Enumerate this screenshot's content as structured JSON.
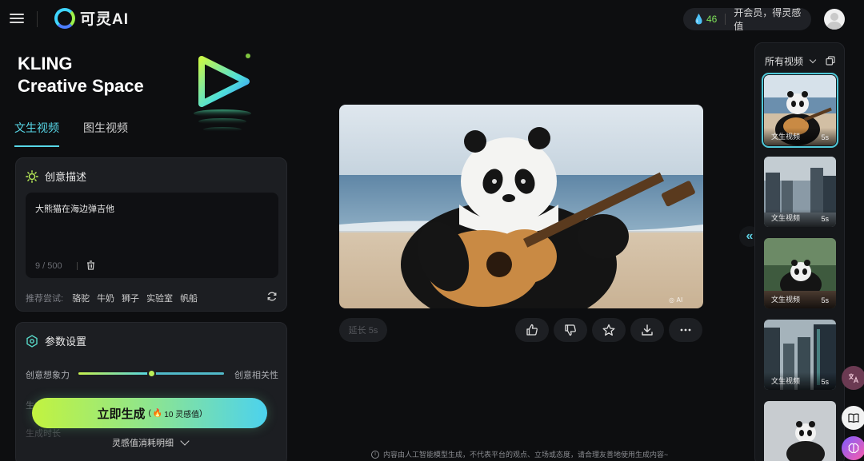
{
  "topbar": {
    "brand": "可灵AI",
    "credits": "46",
    "vip_text": "开会员，得灵感值"
  },
  "hero": {
    "line1": "KLING",
    "line2": "Creative Space"
  },
  "tabs": [
    {
      "label": "文生视频",
      "active": true
    },
    {
      "label": "图生视频",
      "active": false
    }
  ],
  "creative": {
    "title": "创意描述",
    "prompt": "大熊猫在海边弹吉他",
    "char_count": "9 / 500",
    "suggest_label": "推荐尝试:",
    "suggestions": [
      "骆驼",
      "牛奶",
      "狮子",
      "实验室",
      "帆船"
    ]
  },
  "params": {
    "title": "参数设置",
    "slider_left": "创意想象力",
    "slider_right": "创意相关性",
    "slider_value": 0.5,
    "row2_faded": "生成模式",
    "row3_faded": "生成时长"
  },
  "generate": {
    "label": "立即生成",
    "cost": "10 灵感值"
  },
  "cost_detail": "灵感值消耗明细",
  "video": {
    "extend_label": "延长 5s",
    "actions": [
      "thumbs-up-icon",
      "thumbs-down-icon",
      "star-icon",
      "download-icon",
      "more-icon"
    ]
  },
  "disclaimer": "内容由人工智能模型生成，不代表平台的观点、立场或态度，请合理友善地使用生成内容~",
  "rail": {
    "title": "所有视频",
    "items": [
      {
        "type": "文生视频",
        "duration": "5s",
        "active": true,
        "scene": "panda-guitar"
      },
      {
        "type": "文生视频",
        "duration": "5s",
        "active": false,
        "scene": "city-street"
      },
      {
        "type": "文生视频",
        "duration": "5s",
        "active": false,
        "scene": "panda-forest"
      },
      {
        "type": "文生视频",
        "duration": "5s",
        "active": false,
        "scene": "city-towers"
      },
      {
        "type": "",
        "duration": "",
        "active": false,
        "scene": "panda-snow"
      }
    ]
  },
  "colors": {
    "accent": "#58d8e8",
    "generate_start": "#c2f33f",
    "generate_end": "#4cd2ee",
    "background": "#0d0e10"
  }
}
